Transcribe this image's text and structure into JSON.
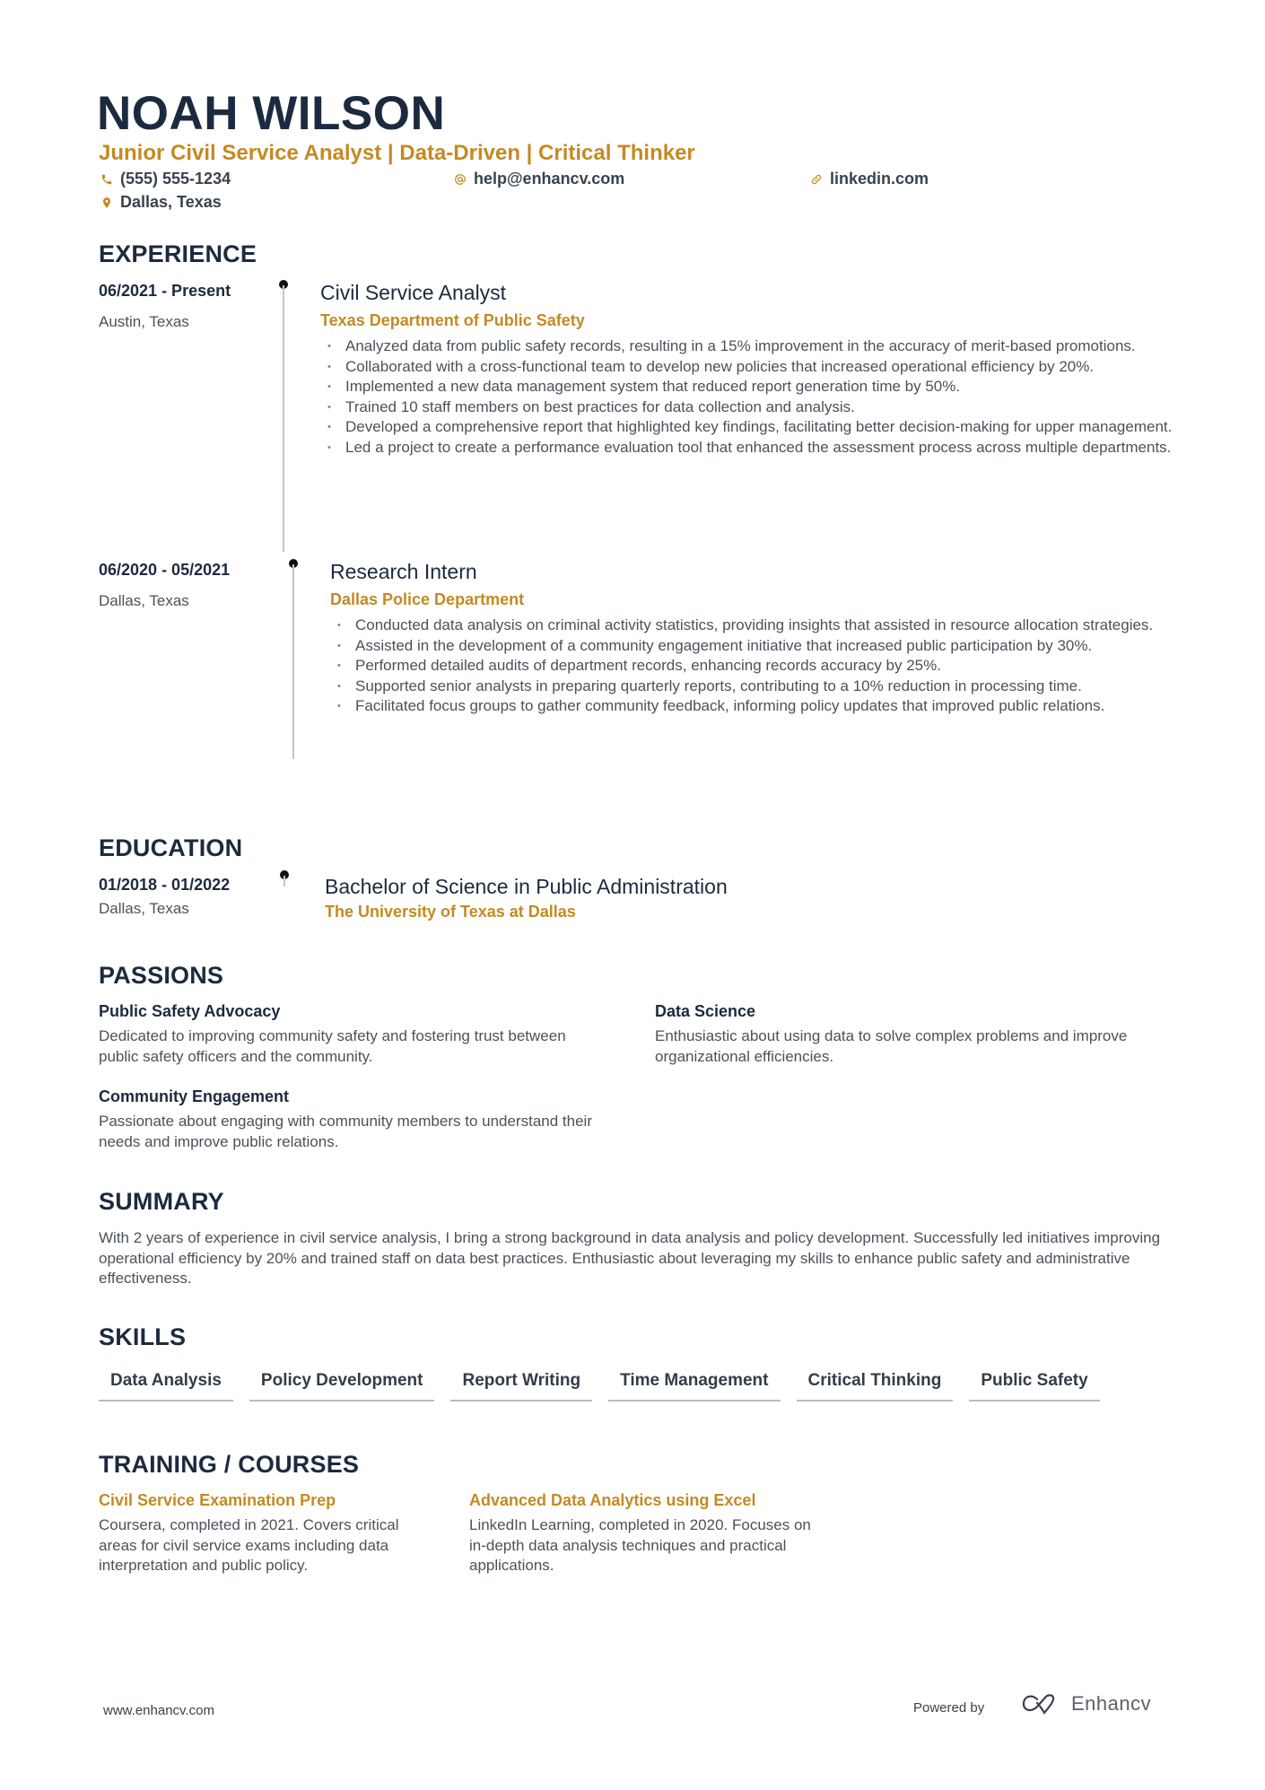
{
  "header": {
    "name": "NOAH WILSON",
    "tagline": "Junior Civil Service Analyst | Data-Driven | Critical Thinker",
    "contacts": {
      "phone": {
        "icon": "phone-icon",
        "value": "(555) 555-1234"
      },
      "email": {
        "icon": "at-icon",
        "value": "help@enhancv.com"
      },
      "linkedin": {
        "icon": "link-icon",
        "value": "linkedin.com"
      },
      "location": {
        "icon": "location-pin-icon",
        "value": "Dallas, Texas"
      }
    },
    "accent_color": "#c48a22",
    "primary_color": "#1c2a3f"
  },
  "experience": {
    "title": "EXPERIENCE",
    "items": [
      {
        "date": "06/2021 - Present",
        "location": "Austin, Texas",
        "role": "Civil Service Analyst",
        "company": "Texas Department of Public Safety",
        "bullets": [
          "Analyzed data from public safety records, resulting in a 15% improvement in the accuracy of merit-based promotions.",
          "Collaborated with a cross-functional team to develop new policies that increased operational efficiency by 20%.",
          "Implemented a new data management system that reduced report generation time by 50%.",
          "Trained 10 staff members on best practices for data collection and analysis.",
          "Developed a comprehensive report that highlighted key findings, facilitating better decision-making for upper management.",
          "Led a project to create a performance evaluation tool that enhanced the assessment process across multiple departments."
        ]
      },
      {
        "date": "06/2020 - 05/2021",
        "location": "Dallas, Texas",
        "role": "Research Intern",
        "company": "Dallas Police Department",
        "bullets": [
          "Conducted data analysis on criminal activity statistics, providing insights that assisted in resource allocation strategies.",
          "Assisted in the development of a community engagement initiative that increased public participation by 30%.",
          "Performed detailed audits of department records, enhancing records accuracy by 25%.",
          "Supported senior analysts in preparing quarterly reports, contributing to a 10% reduction in processing time.",
          "Facilitated focus groups to gather community feedback, informing policy updates that improved public relations."
        ]
      }
    ]
  },
  "education": {
    "title": "EDUCATION",
    "items": [
      {
        "date": "01/2018 - 01/2022",
        "location": "Dallas, Texas",
        "degree": "Bachelor of Science in Public Administration",
        "school": "The University of Texas at Dallas"
      }
    ]
  },
  "passions": {
    "title": "PASSIONS",
    "items": [
      {
        "title": "Public Safety Advocacy",
        "description": "Dedicated to improving community safety and fostering trust between public safety officers and the community."
      },
      {
        "title": "Data Science",
        "description": "Enthusiastic about using data to solve complex problems and improve organizational efficiencies."
      },
      {
        "title": "Community Engagement",
        "description": "Passionate about engaging with community members to understand their needs and improve public relations."
      }
    ]
  },
  "summary": {
    "title": "SUMMARY",
    "text": "With 2 years of experience in civil service analysis, I bring a strong background in data analysis and policy development. Successfully led initiatives improving operational efficiency by 20% and trained staff on data best practices. Enthusiastic about leveraging my skills to enhance public safety and administrative effectiveness."
  },
  "skills": {
    "title": "SKILLS",
    "items": [
      "Data Analysis",
      "Policy Development",
      "Report Writing",
      "Time Management",
      "Critical Thinking",
      "Public Safety"
    ]
  },
  "training": {
    "title": "TRAINING / COURSES",
    "items": [
      {
        "title": "Civil Service Examination Prep",
        "description": "Coursera, completed in 2021. Covers critical areas for civil service exams including data interpretation and public policy."
      },
      {
        "title": "Advanced Data Analytics using Excel",
        "description": "LinkedIn Learning, completed in 2020. Focuses on in-depth data analysis techniques and practical applications."
      }
    ]
  },
  "footer": {
    "url": "www.enhancv.com",
    "powered_by": "Powered by",
    "brand": "Enhancv"
  }
}
